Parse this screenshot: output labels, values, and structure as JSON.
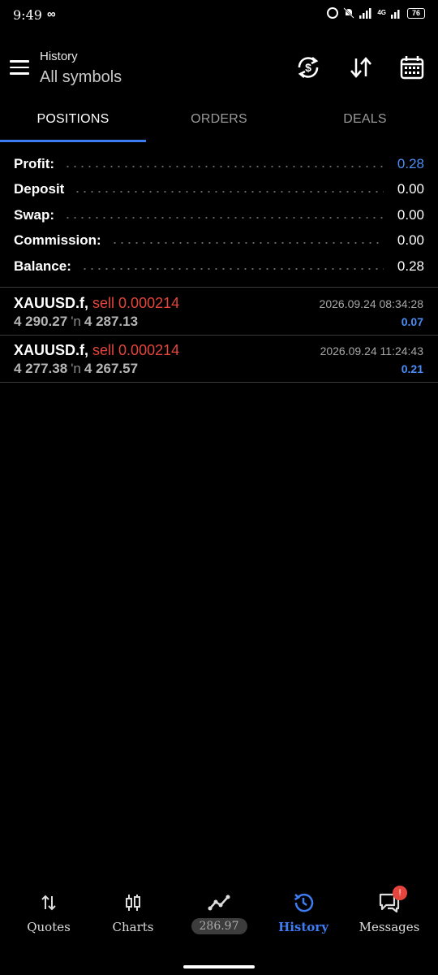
{
  "status": {
    "time": "9:49",
    "infinity": "∞",
    "network": "4G",
    "battery": "76"
  },
  "header": {
    "title": "History",
    "subtitle": "All symbols"
  },
  "tabs": [
    {
      "label": "POSITIONS"
    },
    {
      "label": "ORDERS"
    },
    {
      "label": "DEALS"
    }
  ],
  "summary": {
    "profit": {
      "label": "Profit:",
      "value": "0.28"
    },
    "deposit": {
      "label": "Deposit",
      "value": "0.00"
    },
    "swap": {
      "label": "Swap:",
      "value": "0.00"
    },
    "commission": {
      "label": "Commission:",
      "value": "0.00"
    },
    "balance": {
      "label": "Balance:",
      "value": "0.28"
    }
  },
  "positions": [
    {
      "symbol": "XAUUSD.f,",
      "side": "sell 0.000214",
      "open_price": "4 290.27",
      "arrow": "'n",
      "close_price": "4 287.13",
      "time": "2026.09.24 08:34:28",
      "profit": "0.07"
    },
    {
      "symbol": "XAUUSD.f,",
      "side": "sell 0.000214",
      "open_price": "4 277.38",
      "arrow": "'n",
      "close_price": "4 267.57",
      "time": "2026.09.24 11:24:43",
      "profit": "0.21"
    }
  ],
  "nav": {
    "quotes": "Quotes",
    "charts": "Charts",
    "trade_value": "286.97",
    "history": "History",
    "messages": "Messages",
    "messages_badge": "!"
  },
  "colors": {
    "accent": "#3b7cf0",
    "sell": "#e5453c",
    "background": "#000000"
  }
}
